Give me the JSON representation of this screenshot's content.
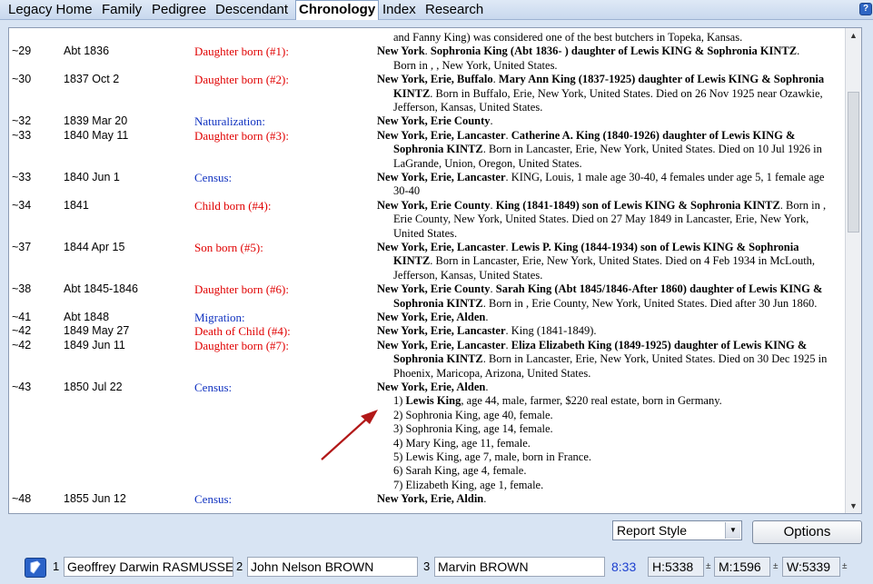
{
  "tabs": [
    {
      "label": "Legacy Home",
      "active": false
    },
    {
      "label": "Family",
      "active": false
    },
    {
      "label": "Pedigree",
      "active": false
    },
    {
      "label": "Descendant",
      "active": false
    },
    {
      "label": "Chronology",
      "active": true
    },
    {
      "label": "Index",
      "active": false
    },
    {
      "label": "Research",
      "active": false
    }
  ],
  "help_label": "?",
  "chronology": {
    "top_continuation": "and Fanny King) was considered one of the best butchers in Topeka, Kansas.",
    "rows": [
      {
        "age": "~29",
        "date": "Abt 1836",
        "event": "Daughter born (#1):",
        "color": "red",
        "lines": [
          "<b>New York</b>.  <b>Sophronia King (Abt 1836-        ) daughter of Lewis KING &amp; Sophronia KINTZ</b>.",
          "Born in , , New York, United States."
        ]
      },
      {
        "age": "~30",
        "date": "1837 Oct 2",
        "event": "Daughter born (#2):",
        "color": "red",
        "lines": [
          "<b>New York, Erie, Buffalo</b>.  <b>Mary Ann King (1837-1925) daughter of Lewis KING &amp; Sophronia</b>",
          "<b>KINTZ</b>.  Born in Buffalo, Erie, New York, United States.  Died on 26 Nov 1925 near Ozawkie,",
          "Jefferson, Kansas, United States."
        ]
      },
      {
        "age": "~32",
        "date": "1839 Mar 20",
        "event": "Naturalization:",
        "color": "blue",
        "lines": [
          "<b>New York, Erie County</b>."
        ]
      },
      {
        "age": "~33",
        "date": "1840 May 11",
        "event": "Daughter born (#3):",
        "color": "red",
        "lines": [
          "<b>New York, Erie, Lancaster</b>.  <b>Catherine A. King (1840-1926) daughter of Lewis KING &amp;</b>",
          "<b>Sophronia KINTZ</b>.  Born in Lancaster, Erie, New York, United States.  Died on 10 Jul 1926 in",
          "LaGrande, Union, Oregon, United States."
        ]
      },
      {
        "age": "~33",
        "date": "1840 Jun 1",
        "event": "Census:",
        "color": "blue",
        "lines": [
          "<b>New York, Erie, Lancaster</b>.  KING, Louis, 1 male age 30-40, 4 females under age 5, 1 female age",
          "30-40"
        ]
      },
      {
        "age": "~34",
        "date": "1841",
        "event": "Child born (#4):",
        "color": "red",
        "lines": [
          "<b>New York, Erie County</b>.  <b>King (1841-1849) son of Lewis KING &amp; Sophronia KINTZ</b>.  Born in ,",
          "Erie County, New York, United States.  Died on 27 May 1849 in Lancaster, Erie, New York,",
          "United States."
        ]
      },
      {
        "age": "~37",
        "date": "1844 Apr 15",
        "event": "Son born (#5):",
        "color": "red",
        "lines": [
          "<b>New York, Erie, Lancaster</b>.  <b>Lewis P. King (1844-1934) son of Lewis KING &amp; Sophronia</b>",
          "<b>KINTZ</b>.  Born in Lancaster, Erie, New York, United States.  Died on 4 Feb 1934 in McLouth,",
          "Jefferson, Kansas, United States."
        ]
      },
      {
        "age": "~38",
        "date": "Abt 1845-1846",
        "event": "Daughter born (#6):",
        "color": "red",
        "lines": [
          "<b>New York, Erie County</b>.  <b>Sarah King (Abt 1845/1846-After 1860) daughter of Lewis KING &amp;</b>",
          "<b>Sophronia KINTZ</b>.  Born in , Erie County, New York, United States.  Died after 30 Jun 1860."
        ]
      },
      {
        "age": "~41",
        "date": "Abt 1848",
        "event": "Migration:",
        "color": "blue",
        "lines": [
          "<b>New York, Erie, Alden</b>."
        ]
      },
      {
        "age": "~42",
        "date": "1849 May 27",
        "event": "Death of Child (#4):",
        "color": "red",
        "lines": [
          "<b>New York, Erie, Lancaster</b>.  King (1841-1849)."
        ]
      },
      {
        "age": "~42",
        "date": "1849 Jun 11",
        "event": "Daughter born (#7):",
        "color": "red",
        "lines": [
          "<b>New York, Erie, Lancaster</b>.  <b>Eliza Elizabeth King (1849-1925) daughter of Lewis KING &amp;</b>",
          "<b>Sophronia KINTZ</b>.  Born in Lancaster, Erie, New York, United States.  Died on 30 Dec 1925 in",
          "Phoenix, Maricopa, Arizona, United States."
        ]
      },
      {
        "age": "~43",
        "date": "1850 Jul 22",
        "event": "Census:",
        "color": "blue",
        "lines": [
          "<b>New York, Erie, Alden</b>.",
          "1) <b>Lewis King</b>, age 44, male, farmer, $220 real estate, born in Germany.",
          "2) Sophronia King, age 40, female.",
          "3) Sophronia King, age 14, female.",
          "4) Mary King, age 11, female.",
          "5) Lewis King, age 7, male, born in France.",
          "6) Sarah King, age 4, female.",
          "7) Elizabeth King, age 1, female."
        ]
      },
      {
        "age": "~48",
        "date": "1855 Jun 12",
        "event": "Census:",
        "color": "blue",
        "lines": [
          "<b>New York, Erie, Aldin</b>."
        ]
      }
    ]
  },
  "report_style": {
    "selected": "Report Style"
  },
  "options_label": "Options",
  "status": {
    "slot1_num": "1",
    "slot1_name": "Geoffrey Darwin RASMUSSEN",
    "slot2_num": "2",
    "slot2_name": "John Nelson BROWN",
    "slot3_num": "3",
    "slot3_name": "Marvin BROWN",
    "time": "8:33",
    "h": "H:5338",
    "m": "M:1596",
    "w": "W:5339",
    "pm": "±"
  }
}
